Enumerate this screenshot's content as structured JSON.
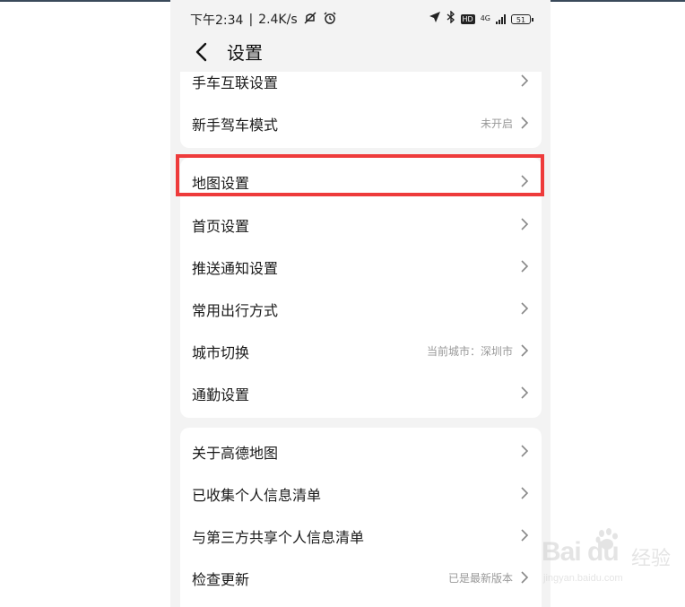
{
  "status_bar": {
    "time": "下午2:34",
    "net_speed": "2.4K/s",
    "network": "4G",
    "battery": "51",
    "hd": "HD"
  },
  "header": {
    "title": "设置"
  },
  "section_top": {
    "items": [
      {
        "label": "手车互联设置",
        "value": ""
      },
      {
        "label": "新手驾车模式",
        "value": "未开启"
      }
    ]
  },
  "section_main": {
    "items": [
      {
        "label": "地图设置",
        "value": ""
      },
      {
        "label": "首页设置",
        "value": ""
      },
      {
        "label": "推送通知设置",
        "value": ""
      },
      {
        "label": "常用出行方式",
        "value": ""
      },
      {
        "label": "城市切换",
        "value": "当前城市：深圳市"
      },
      {
        "label": "通勤设置",
        "value": ""
      }
    ]
  },
  "section_about": {
    "items": [
      {
        "label": "关于高德地图",
        "value": ""
      },
      {
        "label": "已收集个人信息清单",
        "value": ""
      },
      {
        "label": "与第三方共享个人信息清单",
        "value": ""
      },
      {
        "label": "检查更新",
        "value": "已是最新版本"
      }
    ]
  },
  "watermark": {
    "brand": "Bai du",
    "brand_cn": "经验",
    "url": "jingyan.baidu.com"
  },
  "colors": {
    "highlight": "#ee3b3b",
    "background": "#f3f3f3",
    "card": "#ffffff"
  }
}
